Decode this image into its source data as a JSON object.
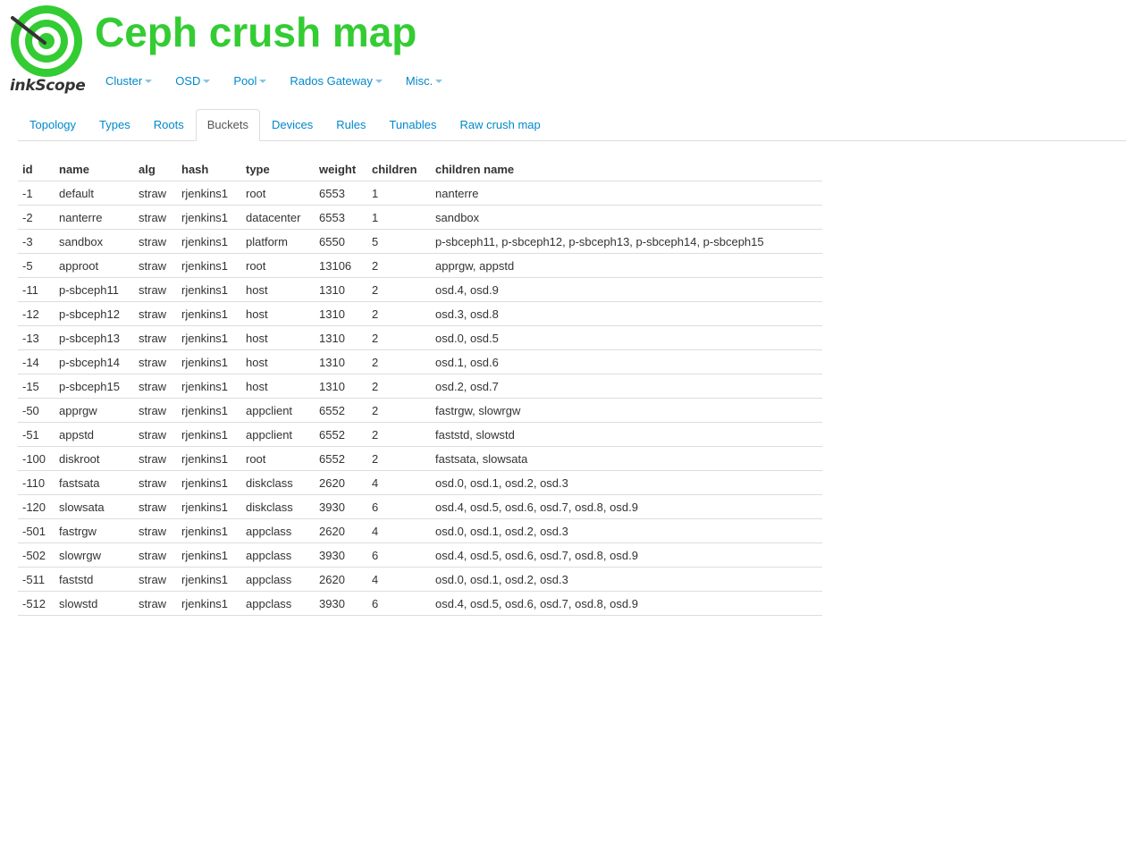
{
  "logo": {
    "text": "inkScope",
    "color": "#33cc33"
  },
  "page_title": "Ceph crush map",
  "menu": [
    {
      "label": "Cluster"
    },
    {
      "label": "OSD"
    },
    {
      "label": "Pool"
    },
    {
      "label": "Rados Gateway"
    },
    {
      "label": "Misc."
    }
  ],
  "tabs": [
    {
      "label": "Topology",
      "active": false
    },
    {
      "label": "Types",
      "active": false
    },
    {
      "label": "Roots",
      "active": false
    },
    {
      "label": "Buckets",
      "active": true
    },
    {
      "label": "Devices",
      "active": false
    },
    {
      "label": "Rules",
      "active": false
    },
    {
      "label": "Tunables",
      "active": false
    },
    {
      "label": "Raw crush map",
      "active": false
    }
  ],
  "table": {
    "headers": [
      "id",
      "name",
      "alg",
      "hash",
      "type",
      "weight",
      "children",
      "children name"
    ],
    "rows": [
      [
        "-1",
        "default",
        "straw",
        "rjenkins1",
        "root",
        "6553",
        "1",
        "nanterre"
      ],
      [
        "-2",
        "nanterre",
        "straw",
        "rjenkins1",
        "datacenter",
        "6553",
        "1",
        "sandbox"
      ],
      [
        "-3",
        "sandbox",
        "straw",
        "rjenkins1",
        "platform",
        "6550",
        "5",
        "p-sbceph11, p-sbceph12, p-sbceph13, p-sbceph14, p-sbceph15"
      ],
      [
        "-5",
        "approot",
        "straw",
        "rjenkins1",
        "root",
        "13106",
        "2",
        "apprgw, appstd"
      ],
      [
        "-11",
        "p-sbceph11",
        "straw",
        "rjenkins1",
        "host",
        "1310",
        "2",
        "osd.4, osd.9"
      ],
      [
        "-12",
        "p-sbceph12",
        "straw",
        "rjenkins1",
        "host",
        "1310",
        "2",
        "osd.3, osd.8"
      ],
      [
        "-13",
        "p-sbceph13",
        "straw",
        "rjenkins1",
        "host",
        "1310",
        "2",
        "osd.0, osd.5"
      ],
      [
        "-14",
        "p-sbceph14",
        "straw",
        "rjenkins1",
        "host",
        "1310",
        "2",
        "osd.1, osd.6"
      ],
      [
        "-15",
        "p-sbceph15",
        "straw",
        "rjenkins1",
        "host",
        "1310",
        "2",
        "osd.2, osd.7"
      ],
      [
        "-50",
        "apprgw",
        "straw",
        "rjenkins1",
        "appclient",
        "6552",
        "2",
        "fastrgw, slowrgw"
      ],
      [
        "-51",
        "appstd",
        "straw",
        "rjenkins1",
        "appclient",
        "6552",
        "2",
        "faststd, slowstd"
      ],
      [
        "-100",
        "diskroot",
        "straw",
        "rjenkins1",
        "root",
        "6552",
        "2",
        "fastsata, slowsata"
      ],
      [
        "-110",
        "fastsata",
        "straw",
        "rjenkins1",
        "diskclass",
        "2620",
        "4",
        "osd.0, osd.1, osd.2, osd.3"
      ],
      [
        "-120",
        "slowsata",
        "straw",
        "rjenkins1",
        "diskclass",
        "3930",
        "6",
        "osd.4, osd.5, osd.6, osd.7, osd.8, osd.9"
      ],
      [
        "-501",
        "fastrgw",
        "straw",
        "rjenkins1",
        "appclass",
        "2620",
        "4",
        "osd.0, osd.1, osd.2, osd.3"
      ],
      [
        "-502",
        "slowrgw",
        "straw",
        "rjenkins1",
        "appclass",
        "3930",
        "6",
        "osd.4, osd.5, osd.6, osd.7, osd.8, osd.9"
      ],
      [
        "-511",
        "faststd",
        "straw",
        "rjenkins1",
        "appclass",
        "2620",
        "4",
        "osd.0, osd.1, osd.2, osd.3"
      ],
      [
        "-512",
        "slowstd",
        "straw",
        "rjenkins1",
        "appclass",
        "3930",
        "6",
        "osd.4, osd.5, osd.6, osd.7, osd.8, osd.9"
      ]
    ]
  }
}
